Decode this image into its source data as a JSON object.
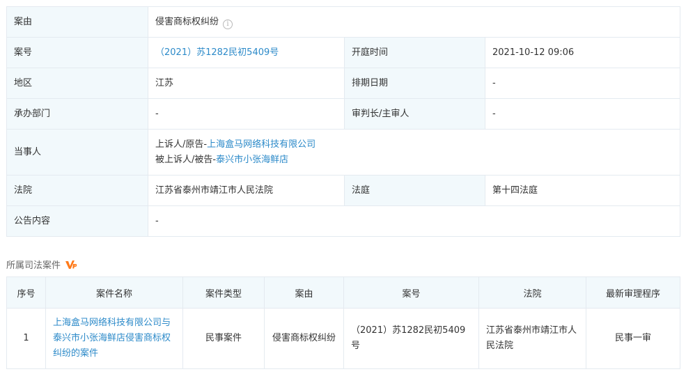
{
  "detail": {
    "cause_label": "案由",
    "cause_value": "侵害商标权纠纷",
    "case_no_label": "案号",
    "case_no_value": "（2021）苏1282民初5409号",
    "hearing_time_label": "开庭时间",
    "hearing_time_value": "2021-10-12 09:06",
    "region_label": "地区",
    "region_value": "江苏",
    "schedule_date_label": "排期日期",
    "schedule_date_value": "-",
    "department_label": "承办部门",
    "department_value": "-",
    "judge_label": "审判长/主审人",
    "judge_value": "-",
    "parties_label": "当事人",
    "appellant_role": "上诉人/原告-",
    "appellant_name": "上海盒马网络科技有限公司",
    "appellee_role": "被上诉人/被告-",
    "appellee_name": "泰兴市小张海鲜店",
    "court_label": "法院",
    "court_value": "江苏省泰州市靖江市人民法院",
    "tribunal_label": "法庭",
    "tribunal_value": "第十四法庭",
    "notice_label": "公告内容",
    "notice_value": "-"
  },
  "related": {
    "title": "所属司法案件",
    "vip_icon_color": "#ff7a1a",
    "headers": [
      "序号",
      "案件名称",
      "案件类型",
      "案由",
      "案号",
      "法院",
      "最新审理程序"
    ],
    "rows": [
      {
        "index": "1",
        "name": "上海盒马网络科技有限公司与泰兴市小张海鲜店侵害商标权纠纷的案件",
        "type": "民事案件",
        "cause": "侵害商标权纠纷",
        "case_no": "（2021）苏1282民初5409号",
        "court": "江苏省泰州市靖江市人民法院",
        "procedure": "民事一审"
      }
    ]
  },
  "colors": {
    "link": "#2c8ac9",
    "label_bg": "#f2f9fc",
    "border": "#e4eaf0"
  }
}
